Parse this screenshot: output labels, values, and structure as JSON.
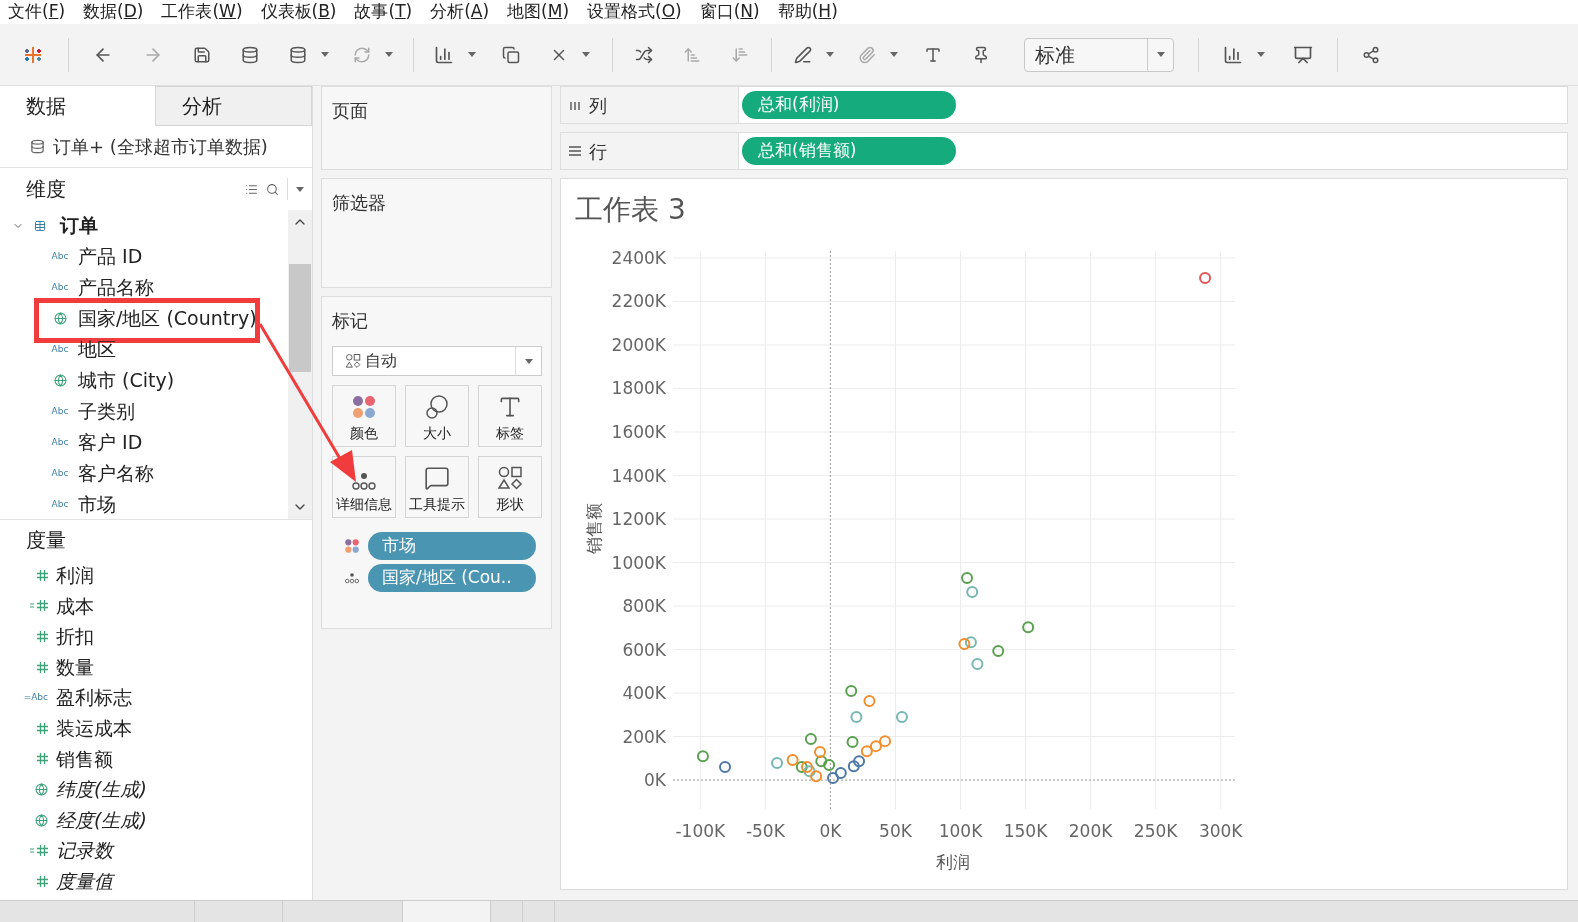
{
  "menu_bar": [
    "文件(F)",
    "数据(D)",
    "工作表(W)",
    "仪表板(B)",
    "故事(T)",
    "分析(A)",
    "地图(M)",
    "设置格式(O)",
    "窗口(N)",
    "帮助(H)"
  ],
  "toolbar": {
    "fit_dropdown": "标准"
  },
  "data_pane": {
    "tabs": [
      {
        "label": "数据",
        "selected": true
      },
      {
        "label": "分析",
        "selected": false
      }
    ],
    "data_source": "订单+ (全球超市订单数据)",
    "dimensions": {
      "title": "维度",
      "folder": {
        "label": "订单",
        "expanded": true,
        "children": [
          {
            "kind": "string",
            "type_label": "Abc",
            "label": "产品 ID",
            "highlighted": false
          },
          {
            "kind": "string",
            "type_label": "Abc",
            "label": "产品名称",
            "highlighted": false
          },
          {
            "kind": "geo",
            "label": "国家/地区 (Country)",
            "highlighted": true
          },
          {
            "kind": "string",
            "type_label": "Abc",
            "label": "地区",
            "highlighted": false
          },
          {
            "kind": "geo",
            "label": "城市 (City)",
            "highlighted": false
          },
          {
            "kind": "string",
            "type_label": "Abc",
            "label": "子类别",
            "highlighted": false
          },
          {
            "kind": "string",
            "type_label": "Abc",
            "label": "客户 ID",
            "highlighted": false
          },
          {
            "kind": "string",
            "type_label": "Abc",
            "label": "客户名称",
            "highlighted": false
          },
          {
            "kind": "string",
            "type_label": "Abc",
            "label": "市场",
            "highlighted": false
          }
        ]
      }
    },
    "measures": {
      "title": "度量",
      "items": [
        {
          "kind": "number",
          "label": "利润",
          "generated": false
        },
        {
          "kind": "calc-number",
          "label": "成本",
          "generated": false
        },
        {
          "kind": "number",
          "label": "折扣",
          "generated": false
        },
        {
          "kind": "number",
          "label": "数量",
          "generated": false
        },
        {
          "kind": "calc-string",
          "type_label": "=Abc",
          "label": "盈利标志",
          "generated": false
        },
        {
          "kind": "number",
          "label": "装运成本",
          "generated": false
        },
        {
          "kind": "number",
          "label": "销售额",
          "generated": false
        },
        {
          "kind": "geo",
          "label": "纬度(生成)",
          "generated": true
        },
        {
          "kind": "geo",
          "label": "经度(生成)",
          "generated": true
        },
        {
          "kind": "calc-number",
          "label": "记录数",
          "generated": true
        },
        {
          "kind": "number",
          "label": "度量值",
          "generated": true
        }
      ]
    }
  },
  "pages": {
    "title": "页面"
  },
  "filters": {
    "title": "筛选器"
  },
  "marks": {
    "title": "标记",
    "mark_type": "自动",
    "buttons": [
      {
        "kind": "color",
        "label": "颜色"
      },
      {
        "kind": "size",
        "label": "大小"
      },
      {
        "kind": "label",
        "label": "标签"
      },
      {
        "kind": "detail",
        "label": "详细信息"
      },
      {
        "kind": "tooltip",
        "label": "工具提示"
      },
      {
        "kind": "shape",
        "label": "形状"
      }
    ],
    "fields": [
      {
        "kind": "color",
        "label": "市场"
      },
      {
        "kind": "detail",
        "label": "国家/地区 (Cou.."
      }
    ]
  },
  "columns_shelf": {
    "label": "列",
    "pill": "总和(利润)"
  },
  "rows_shelf": {
    "label": "行",
    "pill": "总和(销售额)"
  },
  "sheet": {
    "title": "工作表 3",
    "chart_data": {
      "type": "scatter",
      "grid": true,
      "xlabel": "利润",
      "ylabel": "销售额",
      "xlim": [
        -121,
        311
      ],
      "ylim": [
        -133,
        2432
      ],
      "xticks": [
        {
          "value": -100,
          "label": "-100K"
        },
        {
          "value": -50,
          "label": "-50K"
        },
        {
          "value": 0,
          "label": "0K"
        },
        {
          "value": 50,
          "label": "50K"
        },
        {
          "value": 100,
          "label": "100K"
        },
        {
          "value": 150,
          "label": "150K"
        },
        {
          "value": 200,
          "label": "200K"
        },
        {
          "value": 250,
          "label": "250K"
        },
        {
          "value": 300,
          "label": "300K"
        }
      ],
      "yticks": [
        {
          "value": 0,
          "label": "0K"
        },
        {
          "value": 200,
          "label": "200K"
        },
        {
          "value": 400,
          "label": "400K"
        },
        {
          "value": 600,
          "label": "600K"
        },
        {
          "value": 800,
          "label": "800K"
        },
        {
          "value": 1000,
          "label": "1000K"
        },
        {
          "value": 1200,
          "label": "1200K"
        },
        {
          "value": 1400,
          "label": "1400K"
        },
        {
          "value": 1600,
          "label": "1600K"
        },
        {
          "value": 1800,
          "label": "1800K"
        },
        {
          "value": 2000,
          "label": "2000K"
        },
        {
          "value": 2200,
          "label": "2200K"
        },
        {
          "value": 2400,
          "label": "2400K"
        }
      ],
      "series": [
        {
          "color": "#e15759",
          "x": [
            288
          ],
          "values": [
            2308
          ]
        },
        {
          "color": "#59a14f",
          "x": [
            105,
            152,
            129,
            16,
            17,
            -15,
            -98,
            -22,
            -7,
            -1
          ],
          "values": [
            929,
            703,
            593,
            409,
            175,
            189,
            110,
            60,
            87,
            69
          ]
        },
        {
          "color": "#76b7b2",
          "x": [
            109,
            108,
            113,
            20,
            55,
            -41,
            -16
          ],
          "values": [
            864,
            634,
            533,
            290,
            290,
            78,
            41
          ]
        },
        {
          "color": "#f28e2b",
          "x": [
            103,
            30,
            -8,
            -29,
            -18,
            28,
            35,
            42,
            -11
          ],
          "values": [
            625,
            363,
            129,
            92,
            60,
            133,
            156,
            179,
            18
          ]
        },
        {
          "color": "#4e79a7",
          "x": [
            -81,
            22,
            18,
            8,
            2
          ],
          "values": [
            60,
            87,
            64,
            32,
            9
          ]
        }
      ]
    }
  }
}
